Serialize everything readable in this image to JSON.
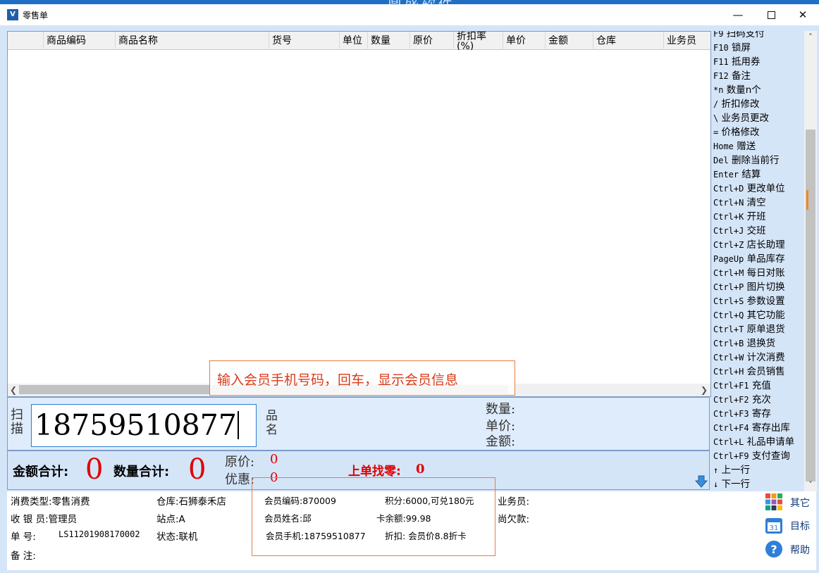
{
  "window": {
    "title": "零售单",
    "app_icon": "app-logo-icon",
    "top_text": "鼎盛软件",
    "controls": [
      "minimize-icon",
      "maximize-icon",
      "close-icon"
    ]
  },
  "grid": {
    "columns": [
      "商品编码",
      "商品名称",
      "货号",
      "单位",
      "数量",
      "原价",
      "折扣率(%)",
      "单价",
      "金额",
      "仓库",
      "业务员"
    ]
  },
  "shortcuts": [
    {
      "key": "F9",
      "label": "扫码支付"
    },
    {
      "key": "F10",
      "label": "锁屏"
    },
    {
      "key": "F11",
      "label": "抵用券"
    },
    {
      "key": "F12",
      "label": "备注"
    },
    {
      "key": "*n",
      "label": " 数量n个"
    },
    {
      "key": "/",
      "label": "折扣修改"
    },
    {
      "key": "\\",
      "label": "业务员更改"
    },
    {
      "key": "=",
      "label": "价格修改"
    },
    {
      "key": "Home",
      "label": "赠送"
    },
    {
      "key": "Del",
      "label": "删除当前行"
    },
    {
      "key": "Enter",
      "label": "结算"
    },
    {
      "key": "Ctrl+D",
      "label": "更改单位"
    },
    {
      "key": "Ctrl+N",
      "label": "清空"
    },
    {
      "key": "Ctrl+K",
      "label": "开班"
    },
    {
      "key": "Ctrl+J",
      "label": "交班"
    },
    {
      "key": "Ctrl+Z",
      "label": "店长助理"
    },
    {
      "key": "PageUp",
      "label": "单品库存"
    },
    {
      "key": "Ctrl+M",
      "label": "每日对账"
    },
    {
      "key": "Ctrl+P",
      "label": "图片切换"
    },
    {
      "key": "Ctrl+S",
      "label": "参数设置"
    },
    {
      "key": "Ctrl+Q",
      "label": "其它功能"
    },
    {
      "key": "Ctrl+T",
      "label": "原单退货"
    },
    {
      "key": "Ctrl+B",
      "label": "退换货"
    },
    {
      "key": "Ctrl+W",
      "label": "计次消费"
    },
    {
      "key": "Ctrl+H",
      "label": "会员销售"
    },
    {
      "key": "Ctrl+F1",
      "label": "充值"
    },
    {
      "key": "Ctrl+F2",
      "label": "充次"
    },
    {
      "key": "Ctrl+F3",
      "label": "寄存"
    },
    {
      "key": "Ctrl+F4",
      "label": "寄存出库"
    },
    {
      "key": "Ctrl+L",
      "label": "礼品申请单"
    },
    {
      "key": "Ctrl+F9",
      "label": "支付查询"
    },
    {
      "key": "↑",
      "label": " 上一行"
    },
    {
      "key": "↓",
      "label": " 下一行"
    }
  ],
  "scan": {
    "label": "扫描",
    "value": "18759510877",
    "product_name_label": "品名",
    "qty_label": "数量:",
    "price_label": "单价:",
    "amount_label": "金额:"
  },
  "totals": {
    "amount_label": "金额合计:",
    "amount_value": "0",
    "qty_label": "数量合计:",
    "qty_value": "0",
    "orig_label": "原价:",
    "orig_value": "0",
    "discount_label": "优惠:",
    "discount_value": "0",
    "change_label": "上单找零:",
    "change_value": "0"
  },
  "info": {
    "consume_type": "消费类型:零售消费",
    "cashier": "收 银 员:管理员",
    "order_no_label": "单     号:",
    "order_no": "LS11201908170002",
    "remark": "备     注:",
    "warehouse": "仓库:石狮泰禾店",
    "site": "站点:A",
    "status": "状态:联机",
    "member_code": "会员编码:870009",
    "member_name": "会员姓名:邱",
    "member_phone": "会员手机:18759510877",
    "points": "积分:6000,可兑180元",
    "card_balance": "卡余额:99.98",
    "member_discount": "折扣: 会员价8.8折卡",
    "salesman": "业务员:",
    "owed": "尚欠款:"
  },
  "side_buttons": [
    {
      "label": "其它",
      "icon": "apps-grid-icon"
    },
    {
      "label": "目标",
      "icon": "calendar-icon"
    },
    {
      "label": "帮助",
      "icon": "help-icon"
    }
  ],
  "annotation": {
    "text": "输入会员手机号码，回车，显示会员信息",
    "color": "#d93b1a"
  },
  "colors": {
    "accent": "#1f6fc4",
    "panel": "#d5e5f8",
    "total_red": "#e00000",
    "annotation_border": "#e87c3e"
  }
}
